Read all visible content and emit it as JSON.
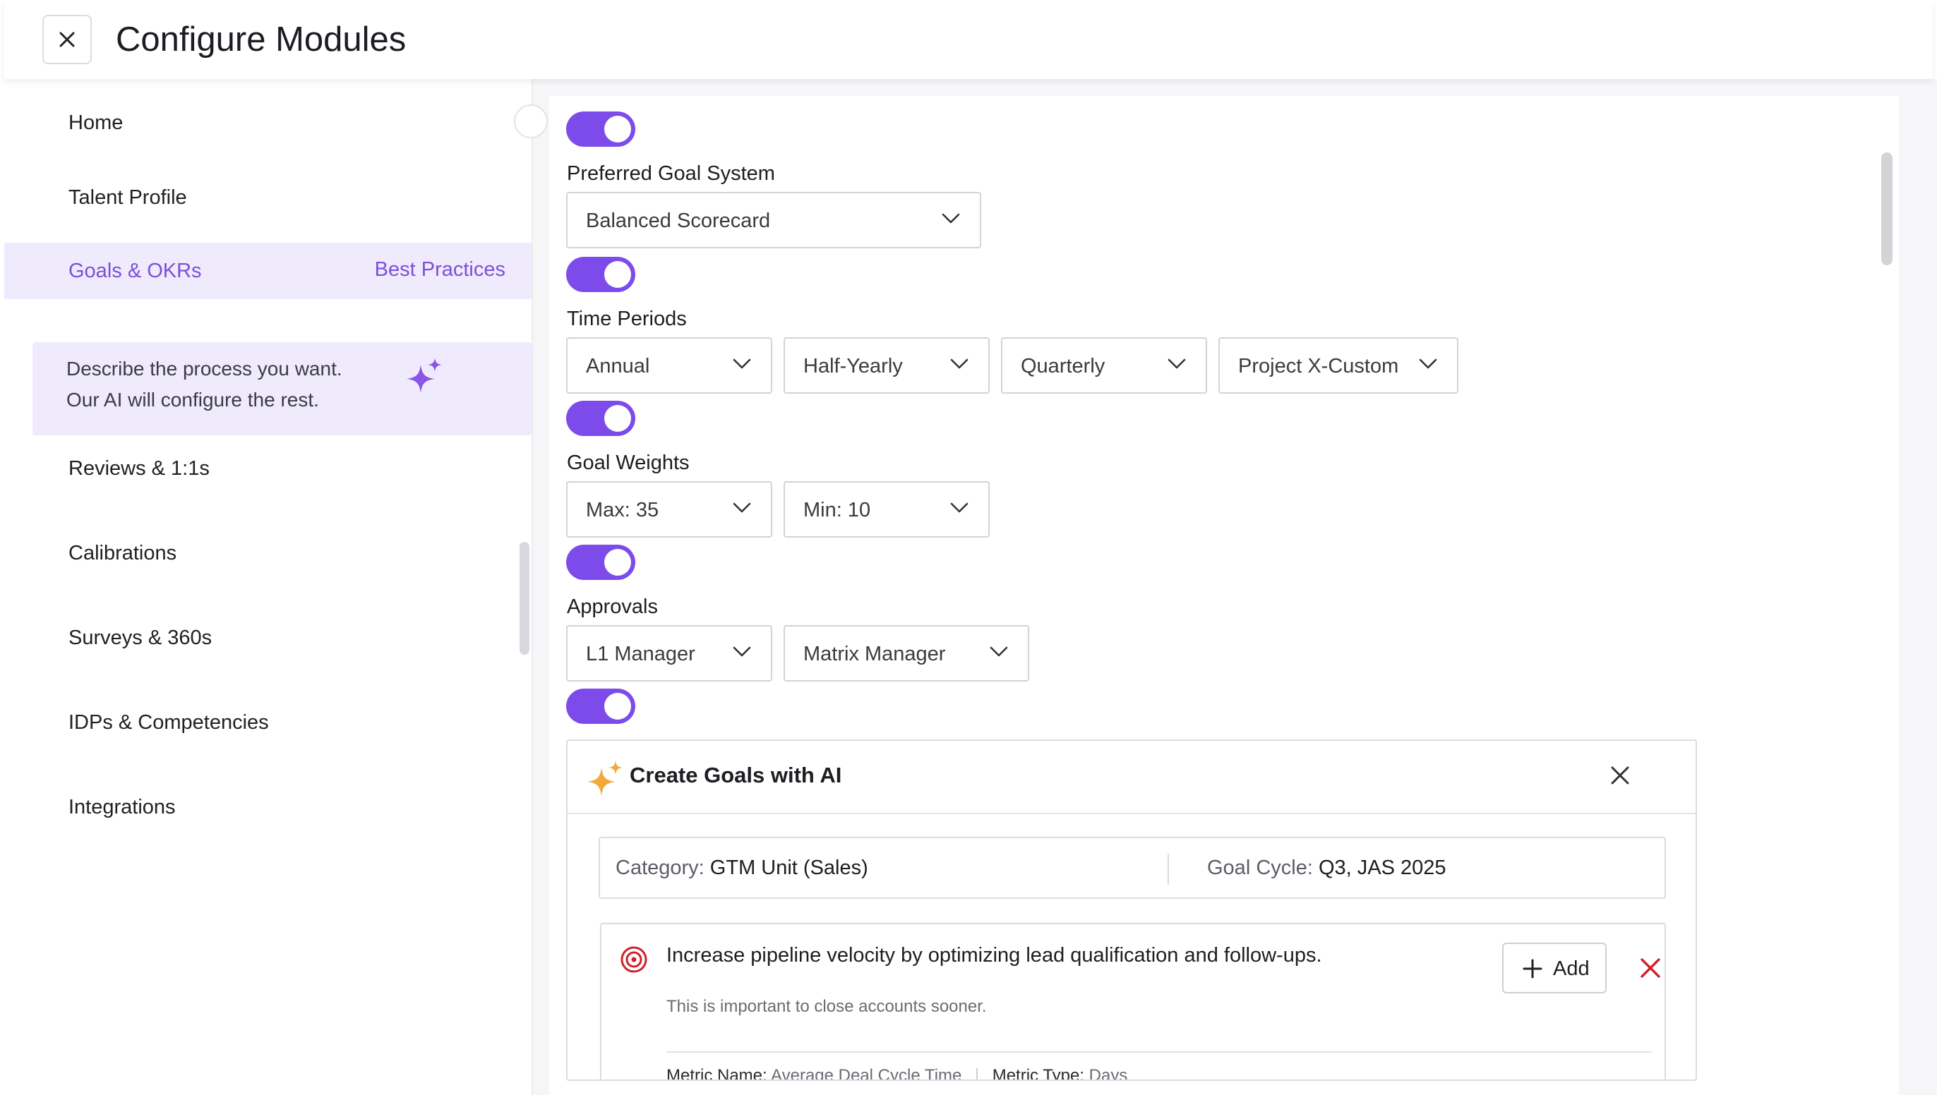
{
  "header": {
    "title": "Configure Modules",
    "close_icon": "close-icon"
  },
  "sidebar": {
    "items": [
      {
        "label": "Home"
      },
      {
        "label": "Talent Profile"
      },
      {
        "label": "Goals & OKRs",
        "action": "Best Practices",
        "active": true
      },
      {
        "label": "Reviews & 1:1s"
      },
      {
        "label": "Calibrations"
      },
      {
        "label": "Surveys & 360s"
      },
      {
        "label": "IDPs & Competencies"
      },
      {
        "label": "Integrations"
      }
    ],
    "ai_prompt": {
      "line1": "Describe the process you want.",
      "line2": "Our AI will configure the rest.",
      "icon": "sparkle-icon"
    }
  },
  "settings": {
    "goal_system": {
      "label": "Preferred Goal System",
      "value": "Balanced Scorecard",
      "enabled": true
    },
    "time_periods": {
      "label": "Time Periods",
      "values": [
        "Annual",
        "Half-Yearly",
        "Quarterly",
        "Project X-Custom"
      ],
      "enabled": true
    },
    "goal_weights": {
      "label": "Goal Weights",
      "values": [
        "Max: 35",
        "Min: 10"
      ],
      "enabled": true
    },
    "approvals": {
      "label": "Approvals",
      "values": [
        "L1 Manager",
        "Matrix Manager"
      ],
      "enabled": true
    },
    "first_toggle_enabled": true,
    "create_goals_enabled": true
  },
  "ai_goals": {
    "title": "Create Goals with AI",
    "category_label": "Category:",
    "category_value": "GTM Unit (Sales)",
    "cycle_label": "Goal Cycle:",
    "cycle_value": "Q3, JAS 2025",
    "goal": {
      "title": "Increase pipeline velocity by optimizing lead qualification and follow-ups.",
      "description": "This is important to close accounts sooner.",
      "metric_name_label": "Metric Name:",
      "metric_name_value": "Average Deal Cycle Time",
      "metric_type_label": "Metric Type:",
      "metric_type_value": "Days",
      "add_label": "Add"
    }
  },
  "colors": {
    "accent": "#7d4bea",
    "accent_text": "#7b4fd9",
    "active_bg": "#f0ebfc",
    "danger": "#d0202c",
    "spark_gold": "#f2a93b"
  }
}
